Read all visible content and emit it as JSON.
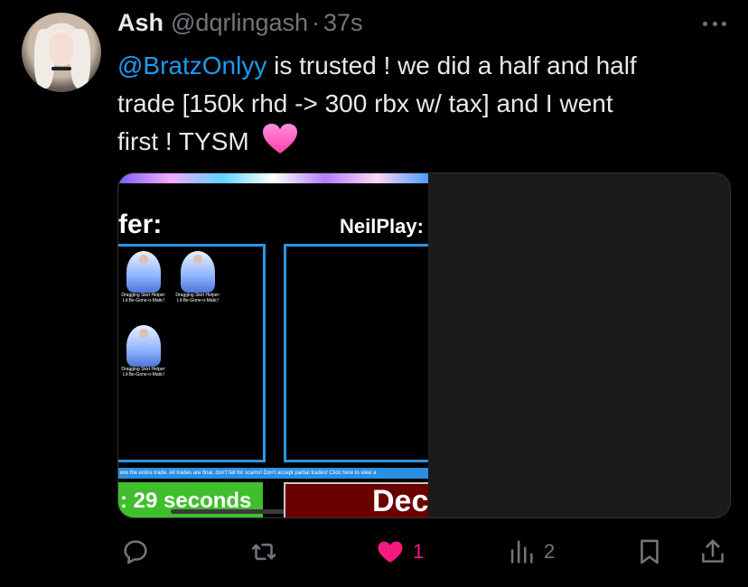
{
  "tweet": {
    "author_name": "Ash",
    "author_handle": "@dqrlingash",
    "separator": "·",
    "time": "37s",
    "mention": "@BratzOnlyy",
    "body_line1_after_mention": " is trusted ! we did a half and half",
    "body_line2": "trade [150k rhd -> 300 rbx w/ tax] and I went",
    "body_line3": "first ! TYSM",
    "emoji": "pink-heart"
  },
  "media": {
    "offer_label": "fer:",
    "partner_label": "NeilPlay:",
    "items": [
      {
        "caption1": "Dragging Skirt Helper:",
        "caption2": "Lil-Be-Gone-o-Matic!"
      },
      {
        "caption1": "Dragging Skirt Helper:",
        "caption2": "Lil-Be-Gone-o-Matic!"
      },
      {
        "caption1": "Dragging Skirt Helper:",
        "caption2": "Lil-Be-Gone-o-Matic!"
      }
    ],
    "notice": "iew the entire trade. All trades are final, don't fall for scams! Don't accept partial trades! Click here to view a",
    "timer_text": ": 29 seconds",
    "decline_text": "Dec"
  },
  "actions": {
    "reply_count": "",
    "retweet_count": "",
    "like_count": "1",
    "views_count": "2"
  },
  "colors": {
    "accent": "#1d9bf0",
    "like": "#f91880",
    "muted": "#71767b"
  }
}
